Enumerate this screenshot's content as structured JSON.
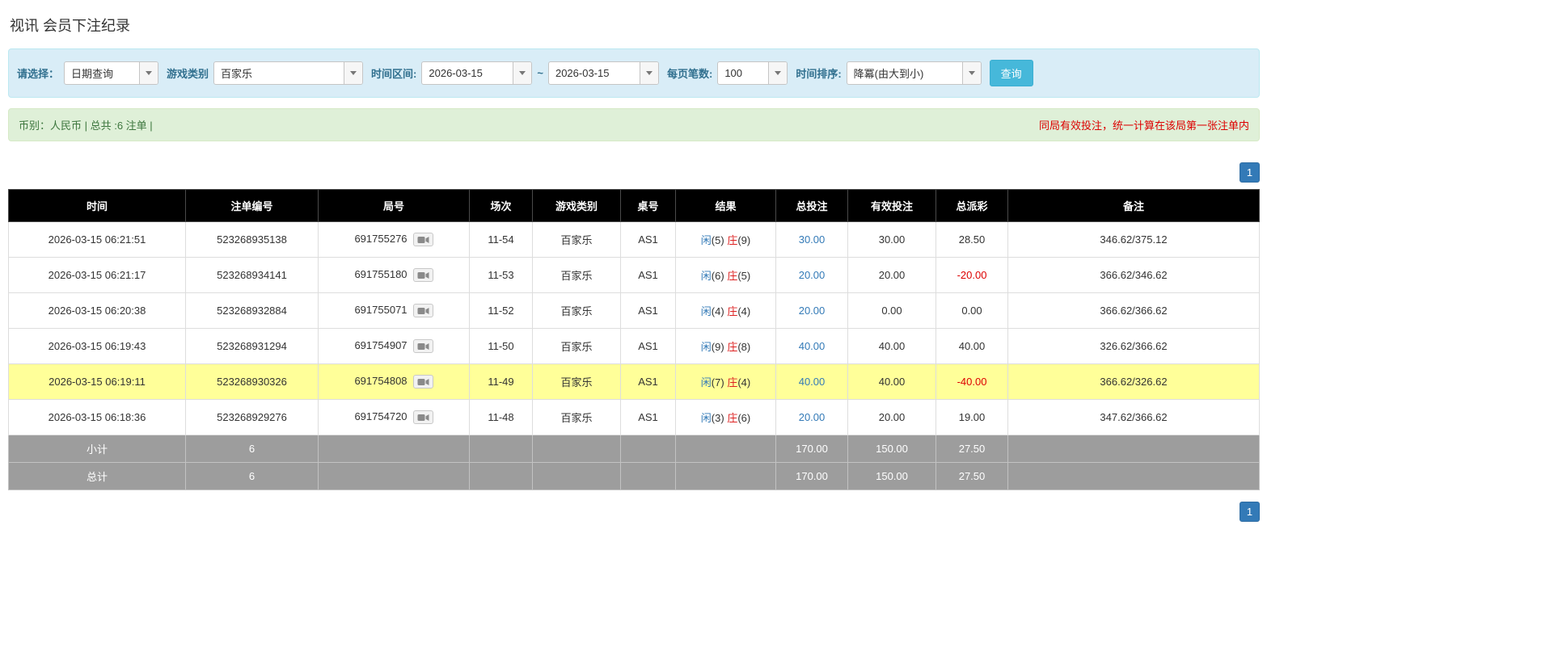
{
  "page": {
    "title": "视讯 会员下注纪录"
  },
  "colors": {
    "filter_bar_bg": "#d9edf7",
    "summary_bar_bg": "#dff0d8",
    "summary_text_green": "#3c763d",
    "notice_red": "#dd0000",
    "header_black": "#000000",
    "footer_gray": "#9d9d9d",
    "highlight_yellow": "#ffff99",
    "link_blue": "#337ab7",
    "banker_red": "#dd2222",
    "search_button_blue": "#46b8da",
    "pagination_blue": "#337ab7"
  },
  "filters": {
    "select_label": "请选择：",
    "select_value": "日期查询",
    "game_type_label": "游戏类别",
    "game_type_value": "百家乐",
    "date_range_label": "时间区间:",
    "date_from": "2026-03-15",
    "date_separator": "~",
    "date_to": "2026-03-15",
    "per_page_label": "每页笔数:",
    "per_page_value": "100",
    "sort_label": "时间排序:",
    "sort_value": "降冪(由大到小)",
    "search_button": "查询"
  },
  "summary": {
    "left": "币别：人民币 | 总共 :6 注单 |",
    "right": "同局有效投注，统一计算在该局第一张注单内"
  },
  "pagination": {
    "page": "1"
  },
  "table": {
    "headers": [
      "时间",
      "注单编号",
      "局号",
      "场次",
      "游戏类别",
      "桌号",
      "结果",
      "总投注",
      "有效投注",
      "总派彩",
      "备注"
    ],
    "rows": [
      {
        "time": "2026-03-15 06:21:51",
        "bet_id": "523268935138",
        "round_id": "691755276",
        "session": "11-54",
        "game": "百家乐",
        "table": "AS1",
        "player": "闲",
        "player_score": "(5)",
        "banker": "庄",
        "banker_score": "(9)",
        "total_bet": "30.00",
        "valid_bet": "30.00",
        "payout": "28.50",
        "note": "346.62/375.12",
        "highlight": false
      },
      {
        "time": "2026-03-15 06:21:17",
        "bet_id": "523268934141",
        "round_id": "691755180",
        "session": "11-53",
        "game": "百家乐",
        "table": "AS1",
        "player": "闲",
        "player_score": "(6)",
        "banker": "庄",
        "banker_score": "(5)",
        "total_bet": "20.00",
        "valid_bet": "20.00",
        "payout": "-20.00",
        "note": "366.62/346.62",
        "highlight": false
      },
      {
        "time": "2026-03-15 06:20:38",
        "bet_id": "523268932884",
        "round_id": "691755071",
        "session": "11-52",
        "game": "百家乐",
        "table": "AS1",
        "player": "闲",
        "player_score": "(4)",
        "banker": "庄",
        "banker_score": "(4)",
        "total_bet": "20.00",
        "valid_bet": "0.00",
        "payout": "0.00",
        "note": "366.62/366.62",
        "highlight": false
      },
      {
        "time": "2026-03-15 06:19:43",
        "bet_id": "523268931294",
        "round_id": "691754907",
        "session": "11-50",
        "game": "百家乐",
        "table": "AS1",
        "player": "闲",
        "player_score": "(9)",
        "banker": "庄",
        "banker_score": "(8)",
        "total_bet": "40.00",
        "valid_bet": "40.00",
        "payout": "40.00",
        "note": "326.62/366.62",
        "highlight": false
      },
      {
        "time": "2026-03-15 06:19:11",
        "bet_id": "523268930326",
        "round_id": "691754808",
        "session": "11-49",
        "game": "百家乐",
        "table": "AS1",
        "player": "闲",
        "player_score": "(7)",
        "banker": "庄",
        "banker_score": "(4)",
        "total_bet": "40.00",
        "valid_bet": "40.00",
        "payout": "-40.00",
        "note": "366.62/326.62",
        "highlight": true
      },
      {
        "time": "2026-03-15 06:18:36",
        "bet_id": "523268929276",
        "round_id": "691754720",
        "session": "11-48",
        "game": "百家乐",
        "table": "AS1",
        "player": "闲",
        "player_score": "(3)",
        "banker": "庄",
        "banker_score": "(6)",
        "total_bet": "20.00",
        "valid_bet": "20.00",
        "payout": "19.00",
        "note": "347.62/366.62",
        "highlight": false
      }
    ],
    "footer": [
      {
        "label": "小计",
        "count": "6",
        "total_bet": "170.00",
        "valid_bet": "150.00",
        "payout": "27.50"
      },
      {
        "label": "总计",
        "count": "6",
        "total_bet": "170.00",
        "valid_bet": "150.00",
        "payout": "27.50"
      }
    ]
  }
}
